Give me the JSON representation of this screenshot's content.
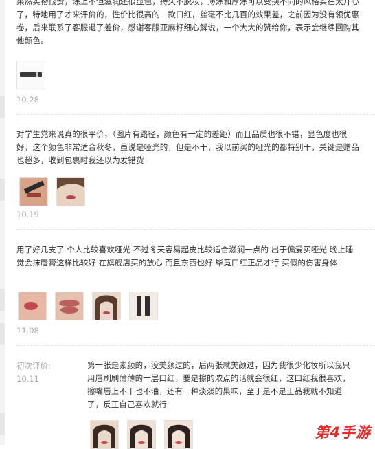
{
  "reviews": [
    {
      "text": "果然实物很赞，涂上不但滋润还很显色，持久不脱妆，薄涂和厚涂可以变换不同的风格实在太开心了，特地用了才来评价的，性价比很高的一款口红，丝毫不比几百的效果差，之前因为没有领优惠卷，后来联系了客服退了差价，感谢客服亚麻籽细心解说，一个大大的赞给你，表示会继续回购其他颜色。",
      "date": "10.28"
    },
    {
      "text": "对学生党来说真的很平价，（图片有路径，颜色有一定的差距）而且品质也很不错，显色度也很好，这个颜色非常适合秋冬，虽说是哑光的，但是不干，我以前买的哑光的都特别干，关键是赠品也超多，收到包裹时我还以为发错货",
      "date": "10.19"
    },
    {
      "text": "用了好几支了 个人比较喜欢哑光 不过冬天容易起皮比较适合滋润一点的 出于偏爱买哑光 晚上睡觉会抹唇膏这样比较好 在旗舰店买的放心 而且东西也好 毕竟口红正品才行 买假的伤害身体",
      "date": "11.08"
    },
    {
      "label": "初次评价:",
      "date": "10.11",
      "text": "第一张是素颜的，没美颜过的，后两张就美颜过，因为我很少化妆所以我只用唇刷刷薄薄的一层口红，要是擦的浓点的话就会很红，这口红我很喜欢，擦嘴唇上不干也不油，还有一种淡淡的果味，至于是不是正品我就不知道了，反正自己喜欢就行"
    }
  ],
  "watermark": "第4手游"
}
